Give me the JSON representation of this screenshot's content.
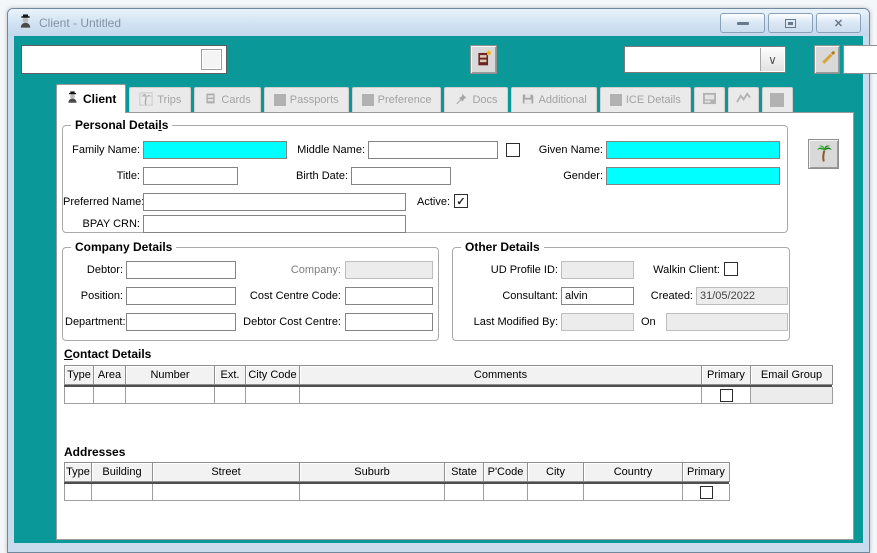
{
  "window": {
    "title": "Client - Untitled"
  },
  "icons": {
    "close": "✕",
    "dropdown": "∨",
    "check": "✓"
  },
  "toolbar": {
    "search_value": "",
    "combo_value": ""
  },
  "tabs": [
    {
      "label": "Client"
    },
    {
      "label": "Trips"
    },
    {
      "label": "Cards"
    },
    {
      "label": "Passports"
    },
    {
      "label": "Preference"
    },
    {
      "label": "Docs"
    },
    {
      "label": "Additional"
    },
    {
      "label": "ICE Details"
    },
    {
      "label": ""
    },
    {
      "label": ""
    },
    {
      "label": ""
    }
  ],
  "personal": {
    "legend_prefix": "Personal Detai",
    "legend_accel": "l",
    "legend_suffix": "s",
    "family_name": "Family Name:",
    "family_value": "",
    "middle_name": "Middle Name:",
    "middle_value": "",
    "given_name": "Given Name:",
    "given_value": "",
    "title": "Title:",
    "title_value": "",
    "birth_date": "Birth Date:",
    "birth_value": "",
    "gender": "Gender:",
    "gender_value": "",
    "preferred_name": "Preferred Name:",
    "preferred_value": "",
    "active": "Active:",
    "bpay_crn": "BPAY CRN:",
    "bpay_value": ""
  },
  "company": {
    "legend": "Company Details",
    "debtor": "Debtor:",
    "debtor_value": "",
    "company": "Company:",
    "company_value": "",
    "position": "Position:",
    "position_value": "",
    "cost_centre_code": "Cost Centre Code:",
    "cost_centre_value": "",
    "department": "Department:",
    "department_value": "",
    "debtor_cost_centre": "Debtor Cost Centre:",
    "debtor_cost_value": ""
  },
  "other": {
    "legend": "Other Details",
    "ud_profile_id": "UD Profile ID:",
    "ud_value": "",
    "walkin_client": "Walkin Client:",
    "consultant": "Consultant:",
    "consultant_value": "alvin",
    "created": "Created:",
    "created_value": "31/05/2022",
    "last_modified_by": "Last Modified By:",
    "last_modified_value": "",
    "on": "On",
    "on_value": ""
  },
  "contact": {
    "title_accel": "C",
    "title_rest": "ontact Details",
    "columns": [
      "Type",
      "Area",
      "Number",
      "Ext.",
      "City Code",
      "Comments",
      "Primary",
      "Email Group"
    ]
  },
  "addresses": {
    "title": "Addresses",
    "columns": [
      "Type",
      "Building",
      "Street",
      "Suburb",
      "State",
      "P'Code",
      "City",
      "Country",
      "Primary"
    ]
  },
  "colors": {
    "teal": "#0a9898",
    "highlight": "#00ffff"
  }
}
